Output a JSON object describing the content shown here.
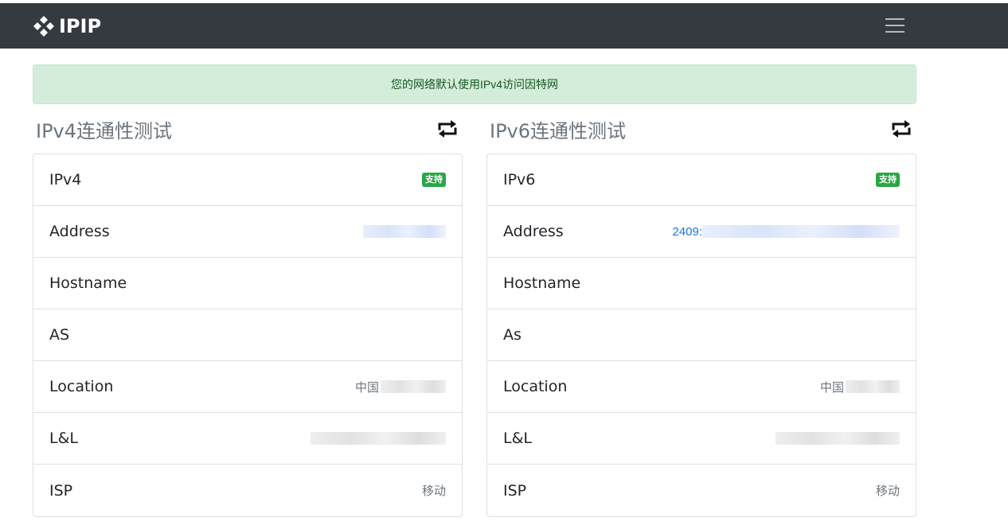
{
  "navbar": {
    "brand": "IPIP",
    "logo_icon": "diamond-logo-icon",
    "menu_icon": "hamburger-menu-icon",
    "bg_color": "#343a40"
  },
  "alert": {
    "text": "您的网络默认使用IPv4访问因特网",
    "bg_color": "#d4edda"
  },
  "ipv4": {
    "title": "IPv4连通性测试",
    "refresh_icon": "refresh-icon",
    "rows": [
      {
        "label": "IPv4",
        "badge": "支持"
      },
      {
        "label": "Address",
        "value": ""
      },
      {
        "label": "Hostname",
        "value": ""
      },
      {
        "label": "AS",
        "value": ""
      },
      {
        "label": "Location",
        "value": "中国"
      },
      {
        "label": "L&L",
        "value": ""
      },
      {
        "label": "ISP",
        "value": "移动"
      }
    ]
  },
  "ipv6": {
    "title": "IPv6连通性测试",
    "refresh_icon": "refresh-icon",
    "rows": [
      {
        "label": "IPv6",
        "badge": "支持"
      },
      {
        "label": "Address",
        "value": "2409:"
      },
      {
        "label": "Hostname",
        "value": ""
      },
      {
        "label": "As",
        "value": ""
      },
      {
        "label": "Location",
        "value": "中国"
      },
      {
        "label": "L&L",
        "value": ""
      },
      {
        "label": "ISP",
        "value": "移动"
      }
    ]
  },
  "colors": {
    "badge_success": "#28a745",
    "link": "#1a73e8"
  }
}
